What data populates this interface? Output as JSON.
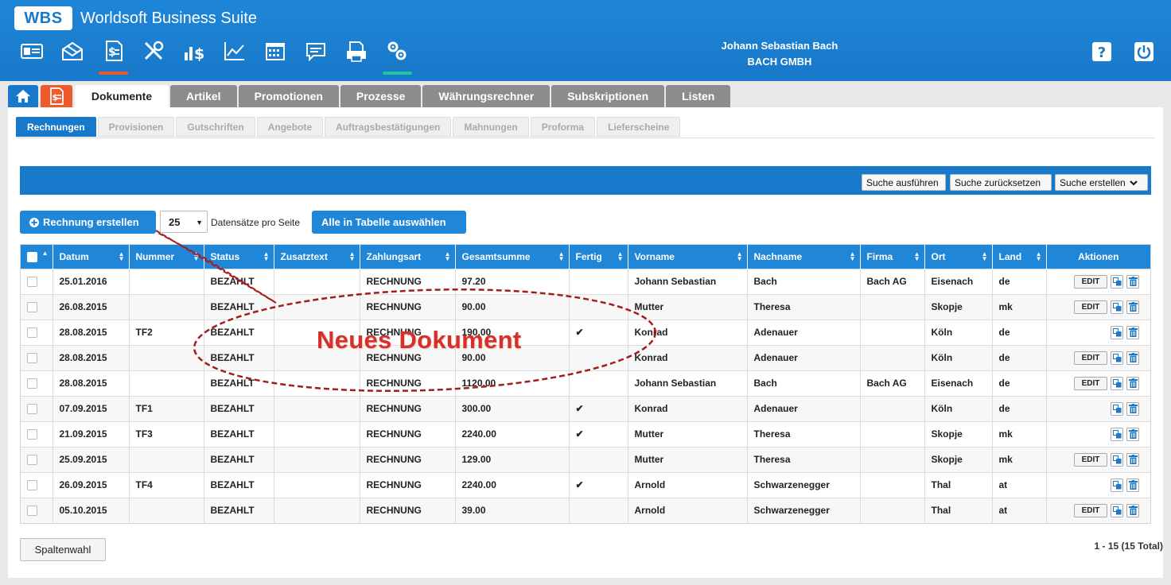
{
  "app": {
    "logo": "WBS",
    "title": "Worldsoft Business Suite"
  },
  "nav_icons": [
    "id-card-icon",
    "mail-icon",
    "document-money-icon",
    "tools-icon",
    "bar-dollar-icon",
    "line-chart-icon",
    "calendar-icon",
    "chat-icon",
    "printer-doc-icon",
    "gears-icon"
  ],
  "user": {
    "name": "Johann Sebastian Bach",
    "company": "BACH GMBH"
  },
  "main_tabs": [
    "Dokumente",
    "Artikel",
    "Promotionen",
    "Prozesse",
    "Währungsrechner",
    "Subskriptionen",
    "Listen"
  ],
  "sub_tabs": [
    "Rechnungen",
    "Provisionen",
    "Gutschriften",
    "Angebote",
    "Auftragsbestätigungen",
    "Mahnungen",
    "Proforma",
    "Lieferscheine"
  ],
  "search": {
    "run": "Suche ausführen",
    "reset": "Suche zurücksetzen",
    "create": "Suche erstellen"
  },
  "toolbar": {
    "create_invoice": "Rechnung erstellen",
    "per_page": "25",
    "per_page_label": "Datensätze pro Seite",
    "select_all": "Alle in Tabelle auswählen"
  },
  "table": {
    "columns": [
      "Datum",
      "Nummer",
      "Status",
      "Zusatztext",
      "Zahlungsart",
      "Gesamtsumme",
      "Fertig",
      "Vorname",
      "Nachname",
      "Firma",
      "Ort",
      "Land",
      "Aktionen"
    ],
    "edit_label": "EDIT",
    "rows": [
      {
        "datum": "25.01.2016",
        "nummer": "",
        "status": "BEZAHLT",
        "zusatz": "",
        "zahlung": "RECHNUNG",
        "summe": "97.20",
        "fertig": "",
        "vorname": "Johann Sebastian",
        "nachname": "Bach",
        "firma": "Bach AG",
        "ort": "Eisenach",
        "land": "de",
        "edit": true
      },
      {
        "datum": "26.08.2015",
        "nummer": "",
        "status": "BEZAHLT",
        "zusatz": "",
        "zahlung": "RECHNUNG",
        "summe": "90.00",
        "fertig": "",
        "vorname": "Mutter",
        "nachname": "Theresa",
        "firma": "",
        "ort": "Skopje",
        "land": "mk",
        "edit": true
      },
      {
        "datum": "28.08.2015",
        "nummer": "TF2",
        "status": "BEZAHLT",
        "zusatz": "",
        "zahlung": "RECHNUNG",
        "summe": "190.00",
        "fertig": "✔",
        "vorname": "Konrad",
        "nachname": "Adenauer",
        "firma": "",
        "ort": "Köln",
        "land": "de",
        "edit": false
      },
      {
        "datum": "28.08.2015",
        "nummer": "",
        "status": "BEZAHLT",
        "zusatz": "",
        "zahlung": "RECHNUNG",
        "summe": "90.00",
        "fertig": "",
        "vorname": "Konrad",
        "nachname": "Adenauer",
        "firma": "",
        "ort": "Köln",
        "land": "de",
        "edit": true
      },
      {
        "datum": "28.08.2015",
        "nummer": "",
        "status": "BEZAHLT",
        "zusatz": "",
        "zahlung": "RECHNUNG",
        "summe": "1120.00",
        "fertig": "",
        "vorname": "Johann Sebastian",
        "nachname": "Bach",
        "firma": "Bach AG",
        "ort": "Eisenach",
        "land": "de",
        "edit": true
      },
      {
        "datum": "07.09.2015",
        "nummer": "TF1",
        "status": "BEZAHLT",
        "zusatz": "",
        "zahlung": "RECHNUNG",
        "summe": "300.00",
        "fertig": "✔",
        "vorname": "Konrad",
        "nachname": "Adenauer",
        "firma": "",
        "ort": "Köln",
        "land": "de",
        "edit": false
      },
      {
        "datum": "21.09.2015",
        "nummer": "TF3",
        "status": "BEZAHLT",
        "zusatz": "",
        "zahlung": "RECHNUNG",
        "summe": "2240.00",
        "fertig": "✔",
        "vorname": "Mutter",
        "nachname": "Theresa",
        "firma": "",
        "ort": "Skopje",
        "land": "mk",
        "edit": false
      },
      {
        "datum": "25.09.2015",
        "nummer": "",
        "status": "BEZAHLT",
        "zusatz": "",
        "zahlung": "RECHNUNG",
        "summe": "129.00",
        "fertig": "",
        "vorname": "Mutter",
        "nachname": "Theresa",
        "firma": "",
        "ort": "Skopje",
        "land": "mk",
        "edit": true
      },
      {
        "datum": "26.09.2015",
        "nummer": "TF4",
        "status": "BEZAHLT",
        "zusatz": "",
        "zahlung": "RECHNUNG",
        "summe": "2240.00",
        "fertig": "✔",
        "vorname": "Arnold",
        "nachname": "Schwarzenegger",
        "firma": "",
        "ort": "Thal",
        "land": "at",
        "edit": false
      },
      {
        "datum": "05.10.2015",
        "nummer": "",
        "status": "BEZAHLT",
        "zusatz": "",
        "zahlung": "RECHNUNG",
        "summe": "39.00",
        "fertig": "",
        "vorname": "Arnold",
        "nachname": "Schwarzenegger",
        "firma": "",
        "ort": "Thal",
        "land": "at",
        "edit": true
      }
    ]
  },
  "footer": {
    "columns_button": "Spaltenwahl",
    "paging": "1 - 15 (15 Total)"
  },
  "annotation": {
    "text": "Neues Dokument",
    "color": "#d6302a"
  }
}
